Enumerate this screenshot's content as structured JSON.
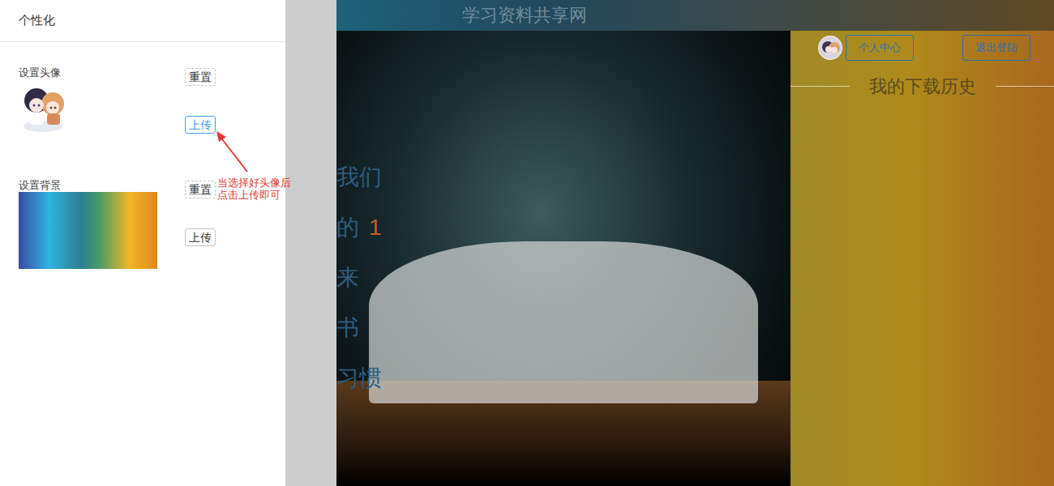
{
  "panel": {
    "title": "个性化",
    "sections": [
      {
        "label": "设置头像",
        "kind": "avatar",
        "buttons": [
          {
            "label": "重置",
            "kind": "reset",
            "highlighted": false
          },
          {
            "label": "上传",
            "kind": "upload",
            "highlighted": true
          }
        ]
      },
      {
        "label": "设置背景",
        "kind": "background",
        "buttons": [
          {
            "label": "重置",
            "kind": "reset",
            "highlighted": false
          },
          {
            "label": "上传",
            "kind": "upload",
            "highlighted": false
          }
        ]
      }
    ]
  },
  "annotation": {
    "text": "当选择好头像后点击上传即可"
  },
  "site": {
    "title": "学习资料共享网",
    "slogan": [
      {
        "text": "我们",
        "number": ""
      },
      {
        "text": "的",
        "number": "1"
      },
      {
        "text": "来",
        "number": ""
      },
      {
        "text": "书",
        "number": ""
      },
      {
        "text": "习惯",
        "number": ""
      }
    ],
    "profile_button": "个人中心",
    "logout_button": "退出登陆",
    "history_title": "我的下载历史"
  }
}
